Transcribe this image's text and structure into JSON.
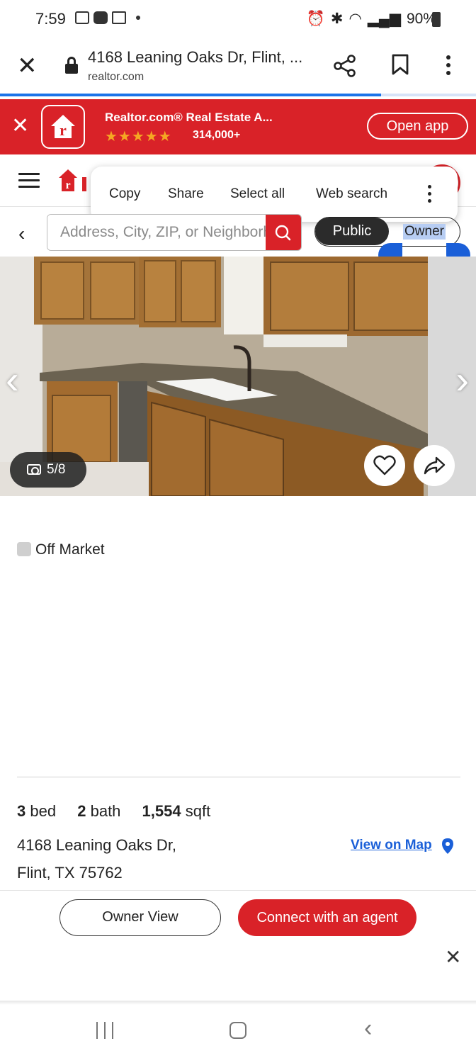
{
  "status_bar": {
    "time": "7:59",
    "battery": "90%",
    "icons": [
      "gallery-icon",
      "youtube-icon",
      "gmail-icon",
      "alarm-icon",
      "bluetooth-icon",
      "wifi-icon",
      "signal-icon",
      "battery-icon"
    ]
  },
  "browser": {
    "page_title": "4168 Leaning Oaks Dr, Flint, ...",
    "domain": "realtor.com",
    "load_progress": 0.8
  },
  "app_banner": {
    "title": "Realtor.com® Real Estate A...",
    "stars": "★★★★★",
    "rating_count": "314,000+",
    "open_label": "Open app"
  },
  "context_menu": {
    "copy": "Copy",
    "share": "Share",
    "select_all": "Select all",
    "web_search": "Web search"
  },
  "search": {
    "placeholder": "Address, City, ZIP, or Neighborhood"
  },
  "view_toggle": {
    "public": "Public",
    "owner": "Owner"
  },
  "photo": {
    "counter": "5/8"
  },
  "listing": {
    "status": "Off Market",
    "beds_value": "3",
    "beds_label": "bed",
    "baths_value": "2",
    "baths_label": "bath",
    "sqft_value": "1,554",
    "sqft_label": "sqft",
    "address_line1": "4168 Leaning Oaks Dr,",
    "address_line2": "Flint, TX 75762",
    "view_on_map": "View on Map"
  },
  "actions": {
    "owner_view": "Owner View",
    "connect_agent": "Connect with an agent"
  },
  "colors": {
    "brand_red": "#d92228",
    "link_blue": "#1a5fd8",
    "star_gold": "#f5a623"
  }
}
